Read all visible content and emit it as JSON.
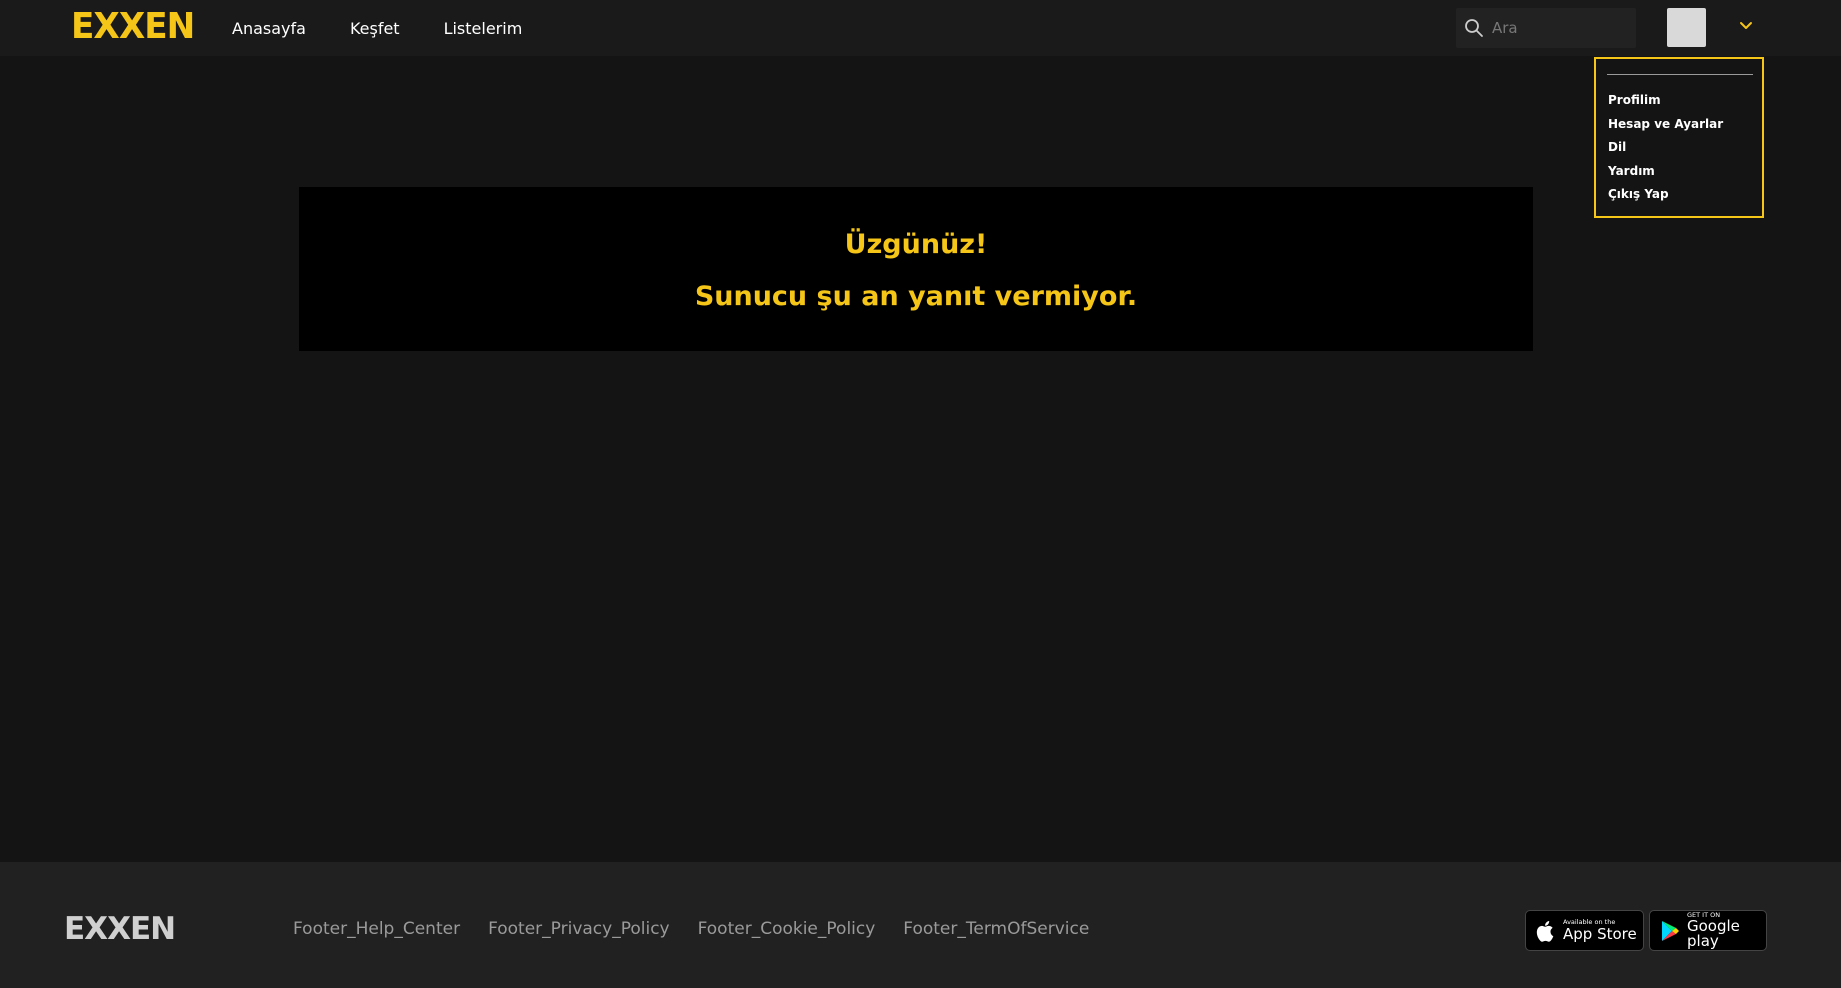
{
  "header": {
    "logo": "EXXEN",
    "nav": [
      "Anasayfa",
      "Keşfet",
      "Listelerim"
    ],
    "search": {
      "placeholder": "Ara",
      "icon": "search-icon"
    }
  },
  "user_menu": {
    "items": [
      "Profilim",
      "Hesap ve Ayarlar",
      "Dil",
      "Yardım",
      "Çıkış Yap"
    ]
  },
  "error": {
    "title": "Üzgünüz!",
    "message": "Sunucu şu an yanıt vermiyor."
  },
  "footer": {
    "logo": "EXXEN",
    "links": [
      "Footer_Help_Center",
      "Footer_Privacy_Policy",
      "Footer_Cookie_Policy",
      "Footer_TermOfService"
    ],
    "appstore": {
      "small": "Available on the",
      "big": "App Store"
    },
    "googleplay": {
      "small": "GET IT ON",
      "big": "Google play"
    }
  },
  "colors": {
    "accent": "#f5c518",
    "background": "#141414",
    "header": "#1a1a1a",
    "footer": "#212121"
  }
}
